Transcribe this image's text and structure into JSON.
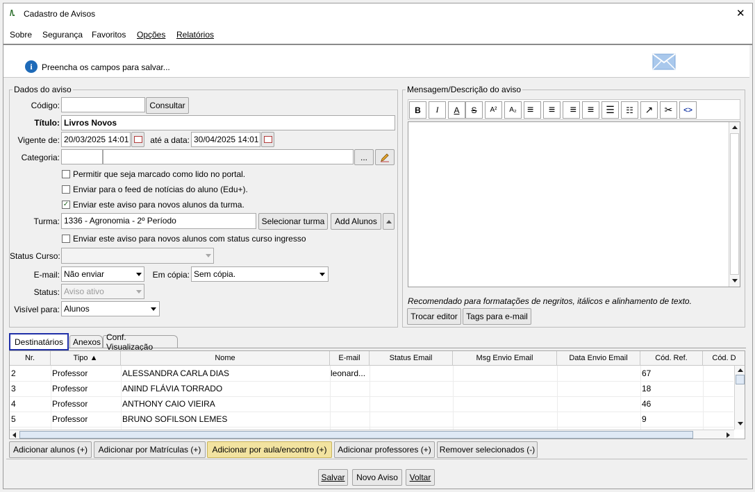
{
  "window": {
    "title": "Cadastro de Avisos",
    "close": "✕"
  },
  "menu": [
    "Sobre",
    "Segurança",
    "Favoritos",
    "Opções",
    "Relatórios"
  ],
  "info": {
    "message": "Preencha os campos para salvar..."
  },
  "dados": {
    "legend": "Dados do aviso",
    "codigo_label": "Código:",
    "codigo_value": "",
    "consultar": "Consultar",
    "titulo_label": "Título:",
    "titulo_value": "Livros Novos",
    "vigente_label": "Vigente de:",
    "vigente_value": "20/03/2025 14:01",
    "ate_label": "até a data:",
    "ate_value": "30/04/2025 14:01",
    "categoria_label": "Categoria:",
    "categoria_code": "",
    "categoria_desc": "",
    "ellipsis": "...",
    "chk1": "Permitir que seja marcado como lido no portal.",
    "chk2": "Enviar para o feed de notícias do aluno (Edu+).",
    "chk3": "Enviar este aviso para novos alunos da turma.",
    "check_mark": "✓",
    "turma_label": "Turma:",
    "turma_value": "1336 - Agronomia - 2º Período",
    "selecionar_turma": "Selecionar turma",
    "add_alunos": "Add Alunos",
    "chk4": "Enviar este aviso para novos alunos com status curso ingresso",
    "status_curso_label": "Status Curso:",
    "status_curso_value": "",
    "email_label": "E-mail:",
    "email_value": "Não enviar",
    "em_copia_label": "Em cópia:",
    "em_copia_value": "Sem cópia.",
    "status_label": "Status:",
    "status_value": "Aviso ativo",
    "visivel_label": "Visível para:",
    "visivel_value": "Alunos"
  },
  "mensagem": {
    "legend": "Mensagem/Descrição do aviso",
    "toolbar": [
      "B",
      "I",
      "A",
      "S",
      "A²",
      "A₂",
      "≡",
      "≡",
      "≡",
      "≡",
      "☰",
      "☷",
      "↗",
      "✂",
      "<>"
    ],
    "hint": "Recomendado para formatações de negritos, itálicos e alinhamento de texto.",
    "trocar_editor": "Trocar editor",
    "tags_email": "Tags para e-mail"
  },
  "tabs": [
    "Destinatários",
    "Anexos",
    "Conf. Visualização"
  ],
  "table": {
    "columns": [
      "Nr.",
      "Tipo ▲",
      "Nome",
      "E-mail",
      "Status Email",
      "Msg Envio Email",
      "Data Envio Email",
      "Cód. Ref.",
      "Cód. D"
    ],
    "rows": [
      [
        "2",
        "Professor",
        "ALESSANDRA CARLA DIAS",
        "leonard...",
        "",
        "",
        "",
        "67",
        ""
      ],
      [
        "3",
        "Professor",
        "ANIND FLÁVIA TORRADO",
        "",
        "",
        "",
        "",
        "18",
        ""
      ],
      [
        "4",
        "Professor",
        "ANTHONY CAIO VIEIRA",
        "",
        "",
        "",
        "",
        "46",
        ""
      ],
      [
        "5",
        "Professor",
        "BRUNO SOFILSON LEMES",
        "",
        "",
        "",
        "",
        "9",
        ""
      ]
    ]
  },
  "bottom_buttons": {
    "adicionar_alunos": "Adicionar alunos (+)",
    "adicionar_matriculas": "Adicionar por Matrículas (+)",
    "adicionar_aula": "Adicionar por aula/encontro (+)",
    "adicionar_professores": "Adicionar professores (+)",
    "remover": "Remover selecionados (-)"
  },
  "footer": {
    "salvar": "Salvar",
    "novo_aviso": "Novo Aviso",
    "voltar": "Voltar"
  },
  "colors": {
    "highlight_button": "#f2e3a0",
    "tab_focus": "#1f2fa8",
    "accent": "#1e6ab8"
  }
}
